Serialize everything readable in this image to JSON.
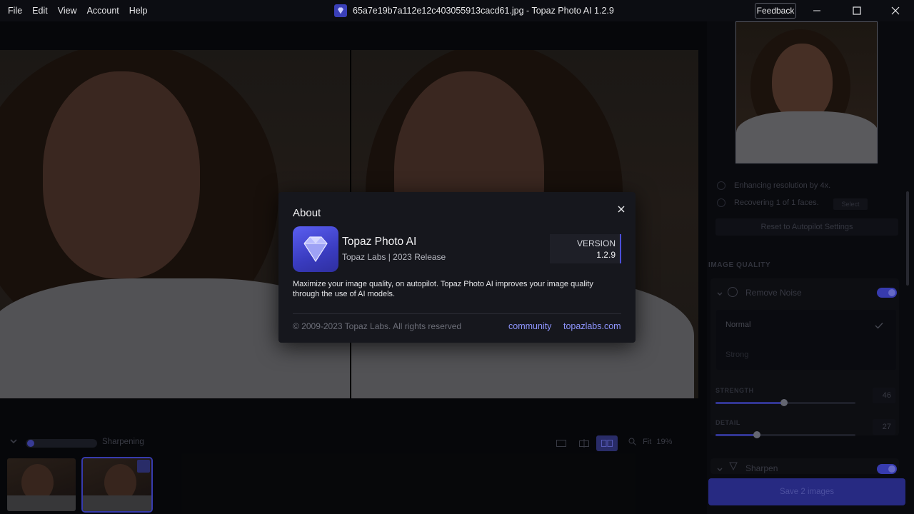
{
  "menu": [
    "File",
    "Edit",
    "View",
    "Account",
    "Help"
  ],
  "window": {
    "title": "65a7e19b7a112e12c403055913cacd61.jpg - Topaz Photo AI 1.2.9",
    "feedback_label": "Feedback"
  },
  "bottom": {
    "status": "Sharpening",
    "zoom_label": "Fit",
    "zoom_value": "19%"
  },
  "panel": {
    "autopilot": {
      "line1": "Enhancing resolution by 4x.",
      "line2": "Recovering 1 of 1 faces.",
      "select_label": "Select",
      "reset_label": "Reset to Autopilot Settings"
    },
    "section_header": "IMAGE QUALITY",
    "remove_noise": {
      "label": "Remove Noise",
      "modes": [
        "Normal",
        "Strong"
      ],
      "selected_mode": "Normal",
      "strength_label": "STRENGTH",
      "strength": 46,
      "detail_label": "DETAIL",
      "detail": 27
    },
    "sharpen_label": "Sharpen",
    "save_label": "Save 2 images"
  },
  "dialog": {
    "title": "About",
    "app_name": "Topaz Photo AI",
    "company": "Topaz Labs | 2023 Release",
    "version_label": "VERSION",
    "version": "1.2.9",
    "description": "Maximize your image quality, on autopilot. Topaz Photo AI improves your image quality through the use of AI models.",
    "copyright": "© 2009-2023 Topaz Labs. All rights reserved",
    "links": [
      "community",
      "topazlabs.com"
    ]
  },
  "colors": {
    "accent": "#3a3fb8",
    "link": "#8f96ff",
    "dialog_bg": "#16171d"
  }
}
